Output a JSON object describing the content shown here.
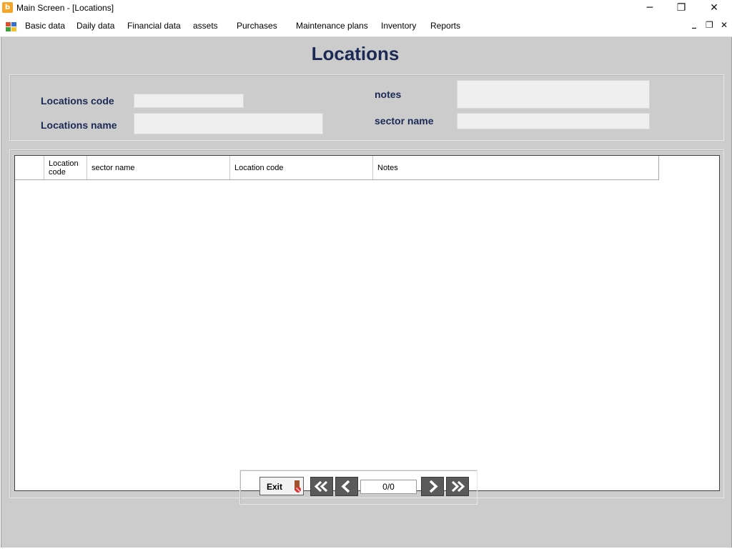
{
  "window": {
    "title": "Main Screen - [Locations]",
    "minimize_glyph": "─",
    "restore_glyph": "❐",
    "close_glyph": "✕"
  },
  "menu": {
    "items": [
      "Basic data",
      "Daily data",
      "Financial data",
      "assets",
      "Purchases",
      "Maintenance plans",
      "Inventory",
      "Reports"
    ],
    "mdi_minimize": "_",
    "mdi_restore": "❐",
    "mdi_close": "✕"
  },
  "form": {
    "heading": "Locations",
    "locations_code_label": "Locations code",
    "locations_name_label": "Locations name",
    "notes_label": "notes",
    "sector_name_label": "sector name",
    "locations_code_value": "",
    "locations_name_value": "",
    "notes_value": "",
    "sector_name_value": ""
  },
  "grid": {
    "columns": [
      "Location code",
      "sector name",
      "Location code",
      "Notes"
    ],
    "rows": []
  },
  "nav": {
    "exit_label": "Exit",
    "position": "0/0"
  },
  "colors": {
    "heading": "#1b2a55",
    "client_bg": "#cccccc",
    "nav_button": "#5a5a5a"
  }
}
